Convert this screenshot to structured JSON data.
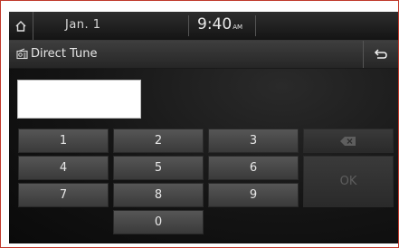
{
  "status": {
    "date": "Jan. 1",
    "time": "9:40",
    "ampm": "AM"
  },
  "title": {
    "label": "Direct Tune"
  },
  "frequency_input": {
    "value": ""
  },
  "keypad": {
    "k1": "1",
    "k2": "2",
    "k3": "3",
    "k4": "4",
    "k5": "5",
    "k6": "6",
    "k7": "7",
    "k8": "8",
    "k9": "9",
    "k0": "0",
    "ok": "OK"
  },
  "icons": {
    "home": "home-icon",
    "radio": "radio-icon",
    "back": "back-arrow-icon",
    "backspace": "backspace-icon"
  },
  "colors": {
    "frame_border": "#c0392b",
    "key_face": "#4a4a4a",
    "disabled_text": "#5e5e5e"
  }
}
